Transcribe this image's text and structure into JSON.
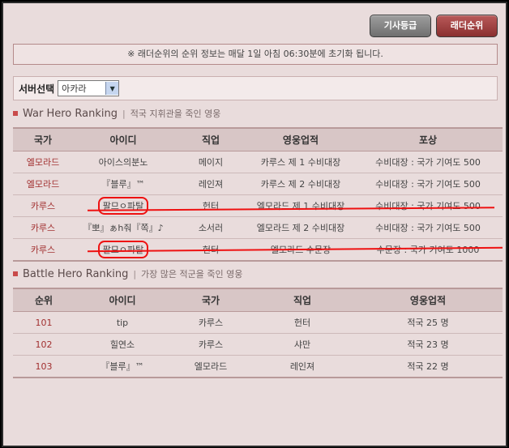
{
  "top_buttons": {
    "knight_rank": "기사등급",
    "ladder_rank": "래더순위"
  },
  "notice": "※ 래더순위의 순위 정보는 매달 1일 아침 06:30분에 초기화 됩니다.",
  "server": {
    "label": "서버선택",
    "selected": "아카라"
  },
  "war": {
    "title": "War Hero Ranking",
    "desc": "적국 지휘관을 죽인 영웅",
    "columns": [
      "국가",
      "아이디",
      "직업",
      "영웅업적",
      "포상"
    ],
    "rows": [
      [
        "엘모라드",
        "아이스의분노",
        "메이지",
        "카루스 제 1 수비대장",
        "수비대장 : 국가 기여도 500"
      ],
      [
        "엘모라드",
        "『블루』™",
        "레인져",
        "카루스 제 2 수비대장",
        "수비대장 : 국가 기여도 500"
      ],
      [
        "카루스",
        "팔므ㅇ파탈",
        "헌터",
        "엘모라드 제 1 수비대장",
        "수비대장 : 국가 기여도 500"
      ],
      [
        "카루스",
        "『뽀』ぁh줘『쪽』♪",
        "소서러",
        "엘모라드 제 2 수비대장",
        "수비대장 : 국가 기여도 500"
      ],
      [
        "카루스",
        "팔므ㅇ파탈",
        "헌터",
        "엘모라드 수문장",
        "수문장 : 국가 기여도 1000"
      ]
    ]
  },
  "battle": {
    "title": "Battle Hero Ranking",
    "desc": "가장 많은 적군을 죽인 영웅",
    "columns": [
      "순위",
      "아이디",
      "국가",
      "직업",
      "영웅업적"
    ],
    "rows": [
      [
        "101",
        "tip",
        "카루스",
        "헌터",
        "적국 25 명"
      ],
      [
        "102",
        "힐연소",
        "카루스",
        "샤만",
        "적국 23 명"
      ],
      [
        "103",
        "『블루』™",
        "엘모라드",
        "레인져",
        "적국 22 명"
      ]
    ]
  },
  "colors": {
    "background": "#e9dcdc",
    "accent": "#a23030",
    "annotation": "#ee1111"
  }
}
